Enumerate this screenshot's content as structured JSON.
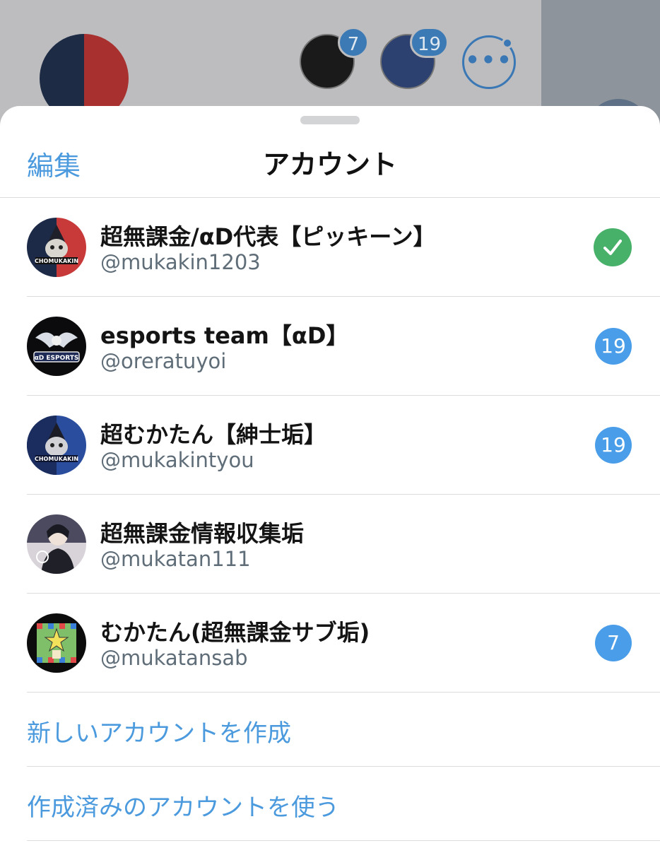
{
  "background": {
    "badges": [
      "7",
      "19"
    ],
    "more_icon": "ellipsis-icon"
  },
  "sheet": {
    "edit_label": "編集",
    "title": "アカウント"
  },
  "accounts": [
    {
      "name": "超無課金/αD代表【ピッキーン】",
      "handle": "@mukakin1203",
      "status": "current",
      "avatar_icon": "chomukakin-red-logo"
    },
    {
      "name": "esports team【αD】",
      "handle": "@oreratuyoi",
      "badge": "19",
      "avatar_icon": "ad-esports-eagle-logo"
    },
    {
      "name": "超むかたん【紳士垢】",
      "handle": "@mukakintyou",
      "badge": "19",
      "avatar_icon": "chomukakin-blue-logo"
    },
    {
      "name": "超無課金情報収集垢",
      "handle": "@mukatan111",
      "avatar_icon": "anime-character-portrait"
    },
    {
      "name": "むかたん(超無課金サブ垢)",
      "handle": "@mukatansab",
      "badge": "7",
      "avatar_icon": "pixel-star-character"
    }
  ],
  "actions": {
    "create_account": "新しいアカウントを作成",
    "use_existing": "作成済みのアカウントを使う"
  },
  "colors": {
    "accent": "#4b9ade",
    "badge": "#4a9de8",
    "check": "#47b069"
  }
}
